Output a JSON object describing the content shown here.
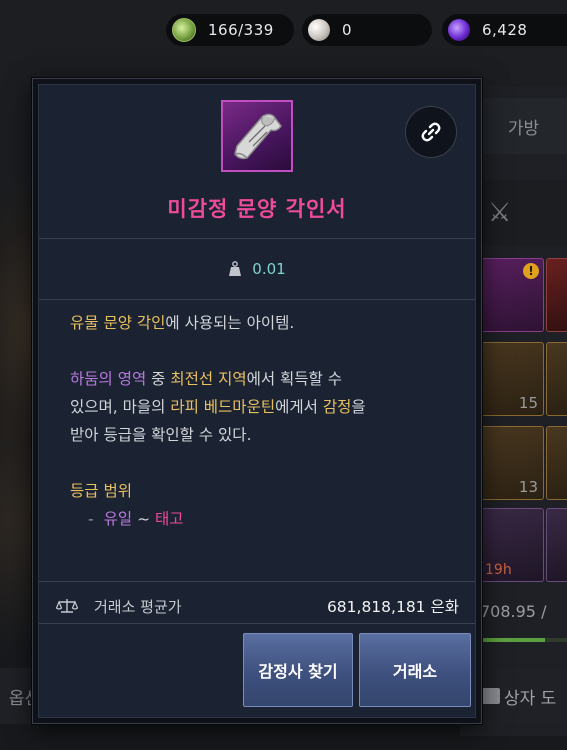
{
  "currency": {
    "ticket": {
      "value": "166/339",
      "icon": "ticket-icon"
    },
    "pearl": {
      "value": "0",
      "icon": "pearl-icon"
    },
    "orb": {
      "value": "6,428",
      "icon": "purple-orb-icon"
    }
  },
  "background": {
    "tab_bag": "가방",
    "slot_counts": [
      "15",
      "13"
    ],
    "timer": "19h",
    "weight": "708.95 /",
    "weight_fill": 0.75,
    "bottom_left_fragment": "옵션",
    "bottom_right_label": "상자 도"
  },
  "item": {
    "name": "미감정 문양 각인서",
    "weight": "0.01",
    "name_color": "#ee4b9b",
    "description": {
      "line1_highlight": "유물 문양 각인",
      "line1_rest": "에 사용되는 아이템.",
      "p2_region": "하둠의 영역",
      "p2_t1": " 중 ",
      "p2_zone": "최전선 지역",
      "p2_t2": "에서 획득할 수",
      "p2_t3": "있으며, 마을의 ",
      "p2_npc": "라피 베드마운틴",
      "p2_t4": "에게서 ",
      "p2_appraise": "감정",
      "p2_t5": "을",
      "p2_t6": "받아 등급을 확인할 수 있다."
    },
    "grade_title": "등급 범위",
    "grade_dash": "-",
    "grade_from": "유일",
    "grade_tilde": "~",
    "grade_to": "태고"
  },
  "market": {
    "avg_label": "거래소 평균가",
    "avg_value": "681,818,181 은화"
  },
  "buttons": {
    "find_appraiser": "감정사 찾기",
    "marketplace": "거래소"
  }
}
